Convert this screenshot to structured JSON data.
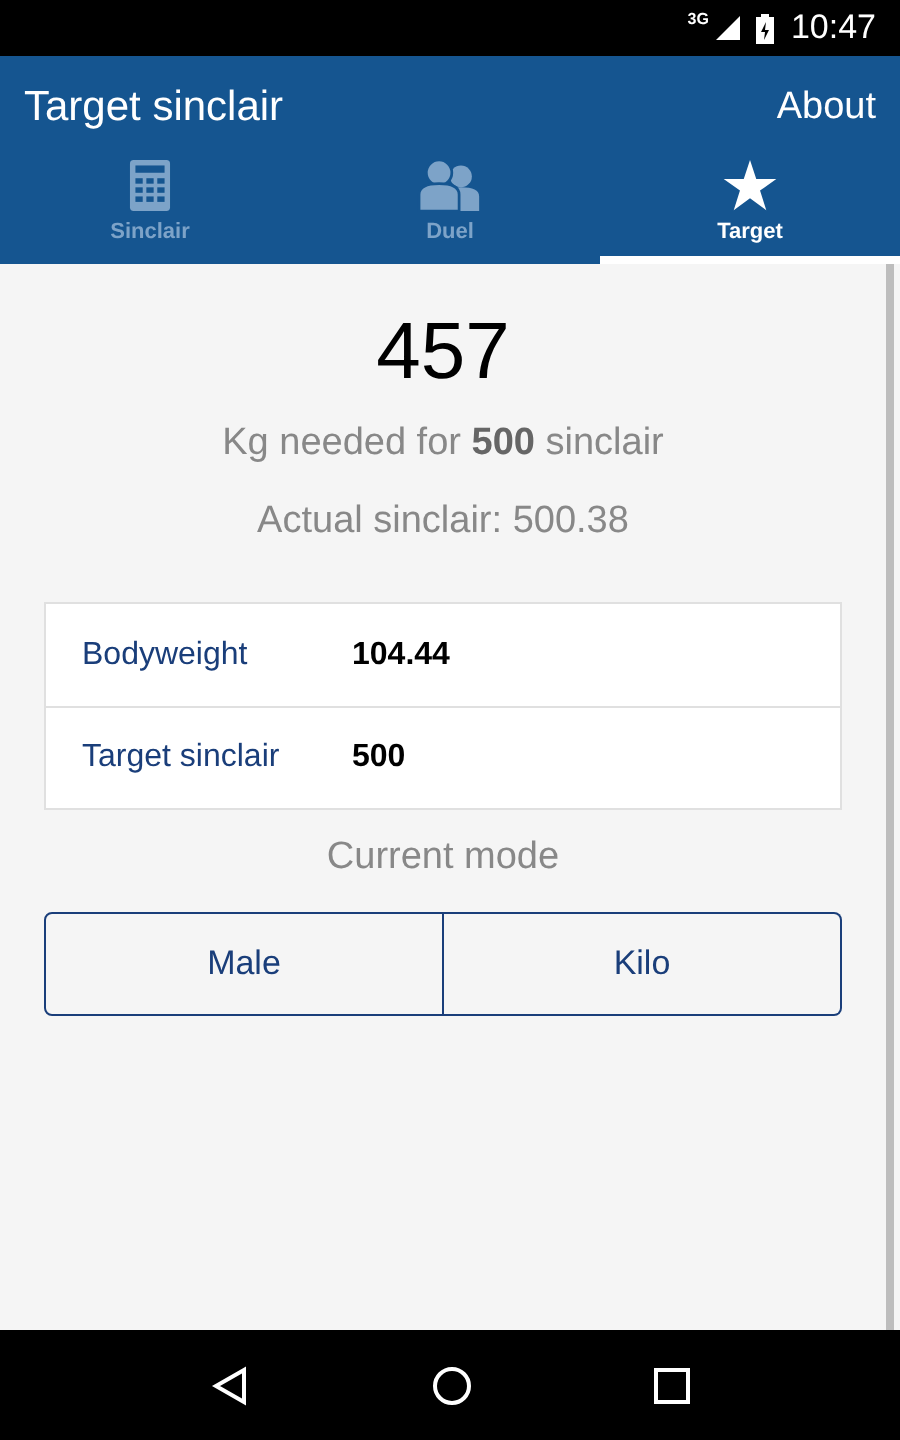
{
  "status_bar": {
    "network": "3G",
    "time": "10:47"
  },
  "app_bar": {
    "title": "Target sinclair",
    "action": "About"
  },
  "tabs": [
    {
      "label": "Sinclair",
      "kind": "calculator",
      "selected": false
    },
    {
      "label": "Duel",
      "kind": "people",
      "selected": false
    },
    {
      "label": "Target",
      "kind": "star",
      "selected": true
    }
  ],
  "result": {
    "value": "457",
    "caption": "Kg needed for **500** sinclair",
    "actual": "Actual sinclair: 500.38"
  },
  "fields": [
    {
      "label": "Bodyweight",
      "value": "104.44"
    },
    {
      "label": "Target sinclair",
      "value": "500"
    }
  ],
  "mode": {
    "title": "Current mode",
    "buttons": [
      "Male",
      "Kilo"
    ]
  }
}
